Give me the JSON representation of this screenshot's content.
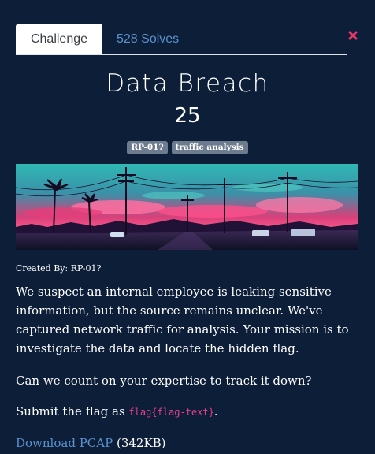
{
  "tabs": {
    "challenge_label": "Challenge",
    "solves_label": "528 Solves"
  },
  "challenge": {
    "title": "Data Breach",
    "points": "25",
    "tags": [
      "RP-01?",
      "traffic analysis"
    ],
    "created_by": "Created By: RP-01?",
    "description": "We suspect an internal employee is leaking sensitive information, but the source remains unclear. We've captured network traffic for analysis. Your mission is to investigate the data and locate the hidden flag.",
    "question": "Can we count on your expertise to track it down?",
    "submit_prefix": "Submit the flag as ",
    "flag_format": "flag{flag-text}",
    "submit_suffix": ".",
    "download_link": "Download PCAP",
    "download_size": " (342KB)"
  },
  "icons": {
    "close": "close-icon",
    "banner": "synthwave-street-banner"
  },
  "colors": {
    "background": "#0c1e38",
    "link": "#5b92cf",
    "close": "#e8356a",
    "tag_bg": "#6c7c8e",
    "code": "#e83e8c"
  }
}
